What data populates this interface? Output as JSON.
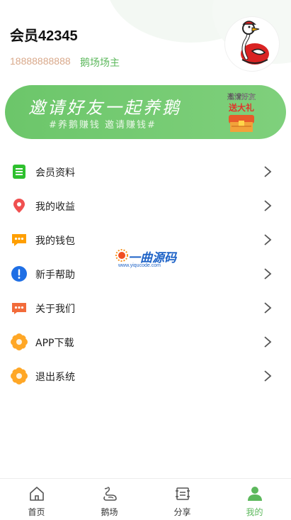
{
  "profile": {
    "username": "会员42345",
    "phone": "18888888888",
    "role": "鹅场场主"
  },
  "banner": {
    "title": "邀请好友一起养鹅",
    "subtitle": "#养鹅赚钱 邀请赚钱#",
    "gift_top": "邀请好友",
    "gift_bottom": "送大礼"
  },
  "menu": {
    "items": [
      {
        "label": "会员资料",
        "icon": "document-list-icon",
        "color": "#2ec02e"
      },
      {
        "label": "我的收益",
        "icon": "location-pin-icon",
        "color": "#f05050"
      },
      {
        "label": "我的钱包",
        "icon": "chat-bubble-icon",
        "color": "#ff9f00"
      },
      {
        "label": "新手帮助",
        "icon": "exclamation-icon",
        "color": "#1f6fe5"
      },
      {
        "label": "关于我们",
        "icon": "message-dots-icon",
        "color": "#f26b3a"
      },
      {
        "label": "APP下载",
        "icon": "flower-icon",
        "color": "#ffa726"
      },
      {
        "label": "退出系统",
        "icon": "flower-icon",
        "color": "#ffa726"
      }
    ]
  },
  "watermark": {
    "text": "一曲源码",
    "url": "www.yiqucode.com"
  },
  "tabbar": {
    "tabs": [
      {
        "label": "首页",
        "icon": "home-icon"
      },
      {
        "label": "鹅场",
        "icon": "goose-icon"
      },
      {
        "label": "分享",
        "icon": "share-list-icon"
      },
      {
        "label": "我的",
        "icon": "person-icon",
        "active": true
      }
    ]
  },
  "colors": {
    "accent": "#5cb85c",
    "banner": "#6cc66a",
    "phone": "#d9a98b"
  }
}
